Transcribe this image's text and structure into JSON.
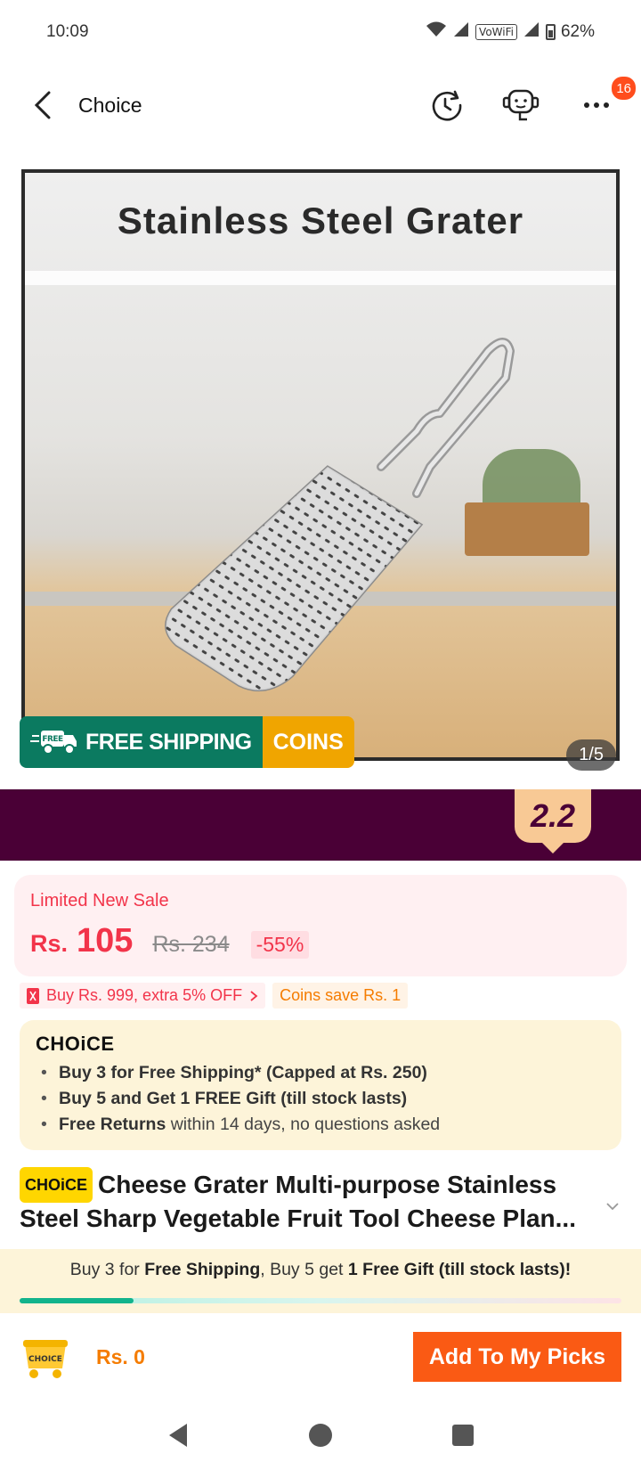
{
  "status_bar": {
    "time": "10:09",
    "network_label": "VoWiFi",
    "battery": "62%"
  },
  "header": {
    "title": "Choice",
    "cart_badge_count": "16"
  },
  "gallery": {
    "image_title": "Stainless Steel Grater",
    "ship_label": "FREE SHIPPING",
    "ship_free_tag": "FREE",
    "coins_label": "COINS",
    "pager": "1/5"
  },
  "promo": {
    "tag": "2.2",
    "band_color": "#4a0036"
  },
  "price": {
    "label": "Limited New Sale",
    "currency": "Rs.",
    "value": "105",
    "original": "Rs. 234",
    "discount": "-55%",
    "accent": "#f2344a"
  },
  "coupons": {
    "red": "Buy Rs. 999, extra 5% OFF",
    "orange": "Coins save Rs. 1"
  },
  "choice_benefits": {
    "logo": "CHOiCE",
    "items": [
      {
        "bold": "Buy 3 for  Free Shipping* (Capped at Rs. 250)",
        "rest": ""
      },
      {
        "bold": "Buy 5 and Get 1 FREE Gift (till stock lasts)",
        "rest": ""
      },
      {
        "bold": "Free Returns",
        "rest": " within 14 days, no questions asked"
      }
    ]
  },
  "product": {
    "choice_pill": "CHOiCE",
    "title": "Cheese Grater Multi-purpose Stainless Steel Sharp Vegetable Fruit Tool Cheese Plan..."
  },
  "bundle": {
    "p1": "Buy 3 for ",
    "b1": "Free Shipping",
    "p2": ", Buy 5 get ",
    "b2": "1 Free Gift (till stock lasts)!",
    "progress": 0.19
  },
  "bottom_bar": {
    "cart_logo": "CHOICE",
    "total": "Rs. 0",
    "add_button": "Add To My Picks"
  },
  "icons": {
    "back": "chevron-left-icon",
    "history": "history-icon",
    "support": "support-bot-icon",
    "more": "more-dots-icon"
  }
}
